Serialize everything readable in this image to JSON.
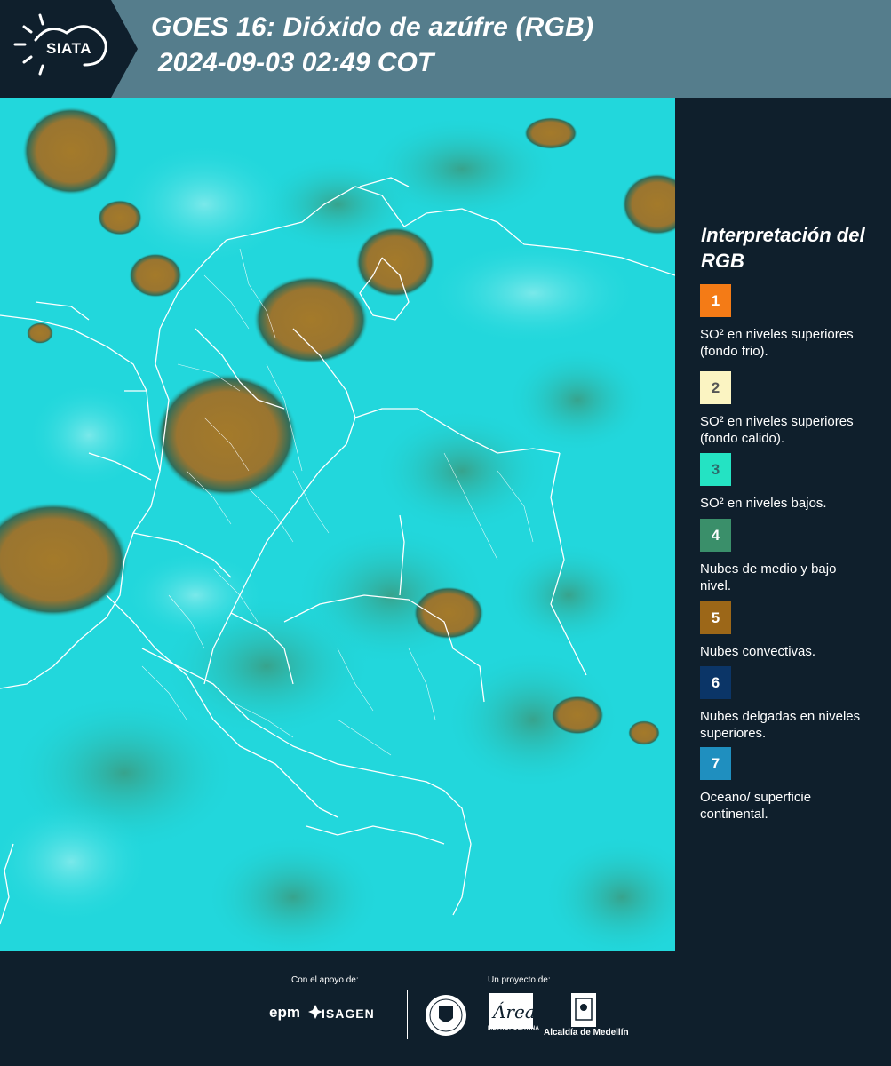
{
  "header": {
    "logo_text": "SIATA",
    "title_line1": "GOES 16: Dióxido de azúfre (RGB)",
    "title_line2": "2024-09-03 02:49 COT",
    "colors": {
      "bar": "#557d8c",
      "logo_panel": "#0f1f2c"
    }
  },
  "map": {
    "icon": "satellite-sulfur-dioxide-rgb-map",
    "colors": {
      "background": "#1ed8dc",
      "convective": "#a47a2a",
      "mid_low": "#3a9a7f",
      "borders": "#ffffff"
    }
  },
  "legend": {
    "title": "Interpretación del RGB",
    "items": [
      {
        "number": "1",
        "description": "SO² en niveles superiores (fondo frio).",
        "color": "#f47b16",
        "text_color": "#ffffff"
      },
      {
        "number": "2",
        "description": "SO² en niveles superiores (fondo calido).",
        "color": "#fbf4c2",
        "text_color": "#555555"
      },
      {
        "number": "3",
        "description": "SO² en niveles bajos.",
        "color": "#24e3c3",
        "text_color": "#2d6a6a"
      },
      {
        "number": "4",
        "description": "Nubes de medio y bajo nivel.",
        "color": "#3a8f6a",
        "text_color": "#ffffff"
      },
      {
        "number": "5",
        "description": "Nubes convectivas.",
        "color": "#9c6718",
        "text_color": "#ffffff"
      },
      {
        "number": "6",
        "description": "Nubes delgadas en niveles superiores.",
        "color": "#0b3567",
        "text_color": "#ffffff"
      },
      {
        "number": "7",
        "description": "Oceano/ superficie continental.",
        "color": "#1f8fbf",
        "text_color": "#ffffff"
      }
    ]
  },
  "footer": {
    "support_label": "Con el apoyo de:",
    "project_label": "Un proyecto de:",
    "sponsor_1": "epm",
    "sponsor_2": "ISAGEN",
    "partner_1_text": "METROPOLITANA",
    "partner_2_text": "Alcaldía de Medellín",
    "partner_1_icon": "area-metropolitana-logo",
    "partner_2_icon": "alcaldia-medellin-logo",
    "seal_icon": "medellin-seal"
  }
}
